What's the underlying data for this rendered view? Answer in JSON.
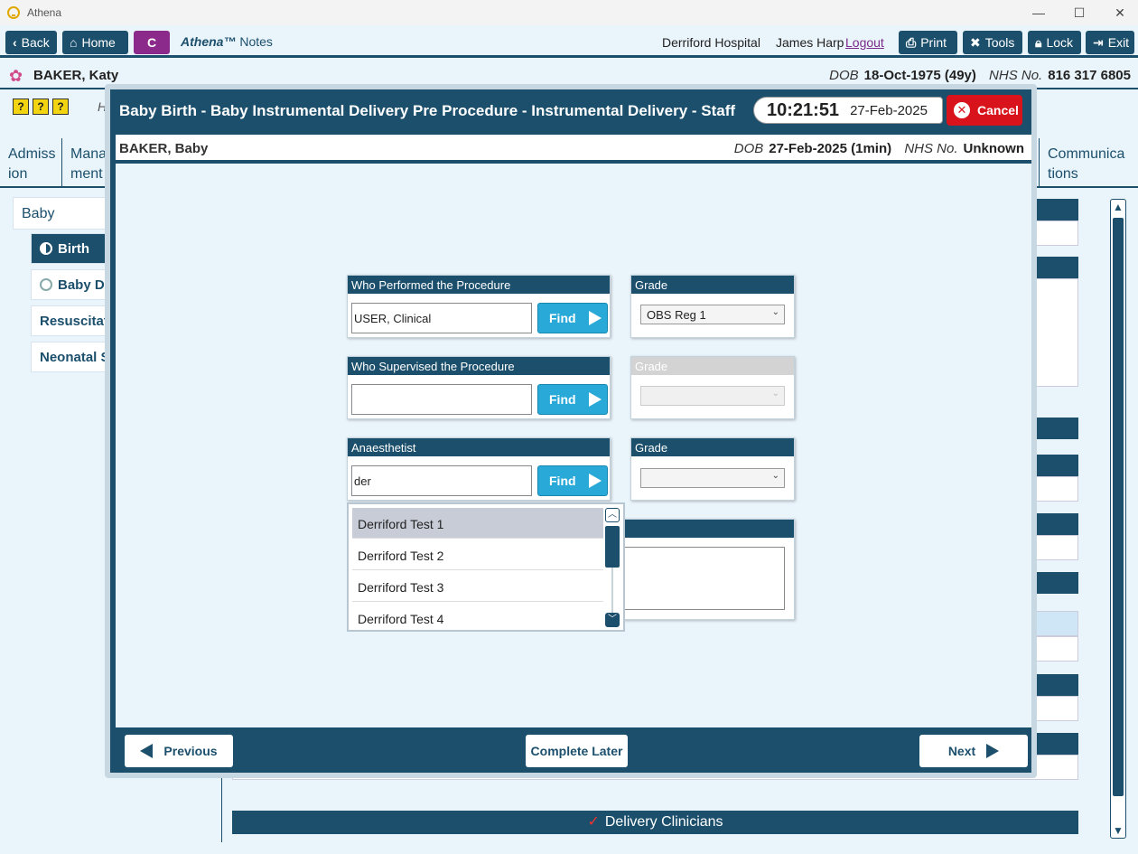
{
  "window": {
    "title": "Athena"
  },
  "toolbar": {
    "back_label": "Back",
    "home_label": "Home",
    "c_label": "C",
    "brand_name": "Athena™",
    "brand_suffix": "Notes",
    "hospital": "Derriford Hospital",
    "user": "James Harp",
    "logout_label": "Logout",
    "print_label": "Print",
    "tools_label": "Tools",
    "lock_label": "Lock",
    "exit_label": "Exit"
  },
  "patient": {
    "name": "BAKER, Katy",
    "dob_label": "DOB",
    "dob": "18-Oct-1975 (49y)",
    "nhs_label": "NHS No.",
    "nhs": "816 317 6805"
  },
  "background": {
    "help_icons": [
      "?",
      "?",
      "?"
    ],
    "header_fragment": "H",
    "tabs": [
      "Admiss ion",
      "Mana ment",
      "Communica tions"
    ],
    "nav": {
      "baby": "Baby",
      "birth": "Birth",
      "baby_details": "Baby De",
      "resuscitation": "Resuscitati",
      "neonatal": "Neonatal S"
    },
    "delivery_clinicians": "Delivery Clinicians"
  },
  "modal": {
    "title": "Baby Birth - Baby Instrumental Delivery Pre Procedure - Instrumental Delivery - Staff",
    "time": "10:21:51",
    "date": "27-Feb-2025",
    "cancel_label": "Cancel",
    "baby": {
      "name": "BAKER, Baby",
      "dob_label": "DOB",
      "dob": "27-Feb-2025 (1min)",
      "nhs_label": "NHS No.",
      "nhs": "Unknown"
    },
    "form": {
      "performed": {
        "label": "Who Performed the Procedure",
        "value": "USER, Clinical",
        "find_label": "Find"
      },
      "performed_grade": {
        "label": "Grade",
        "value": "OBS Reg 1"
      },
      "supervised": {
        "label": "Who Supervised the Procedure",
        "value": "",
        "find_label": "Find"
      },
      "supervised_grade": {
        "label": "Grade",
        "value": ""
      },
      "anaesthetist": {
        "label": "Anaesthetist",
        "value": "der",
        "find_label": "Find"
      },
      "anaesthetist_grade": {
        "label": "Grade",
        "value": ""
      }
    },
    "dropdown": [
      "Derriford Test 1",
      "Derriford Test 2",
      "Derriford Test 3",
      "Derriford Test 4"
    ],
    "footer": {
      "previous_label": "Previous",
      "complete_later_label": "Complete Later",
      "next_label": "Next"
    }
  },
  "colors": {
    "primary": "#1b4f6c",
    "accent_find": "#29a9d8",
    "cancel": "#d8131c",
    "c_button": "#8c2a8c"
  }
}
